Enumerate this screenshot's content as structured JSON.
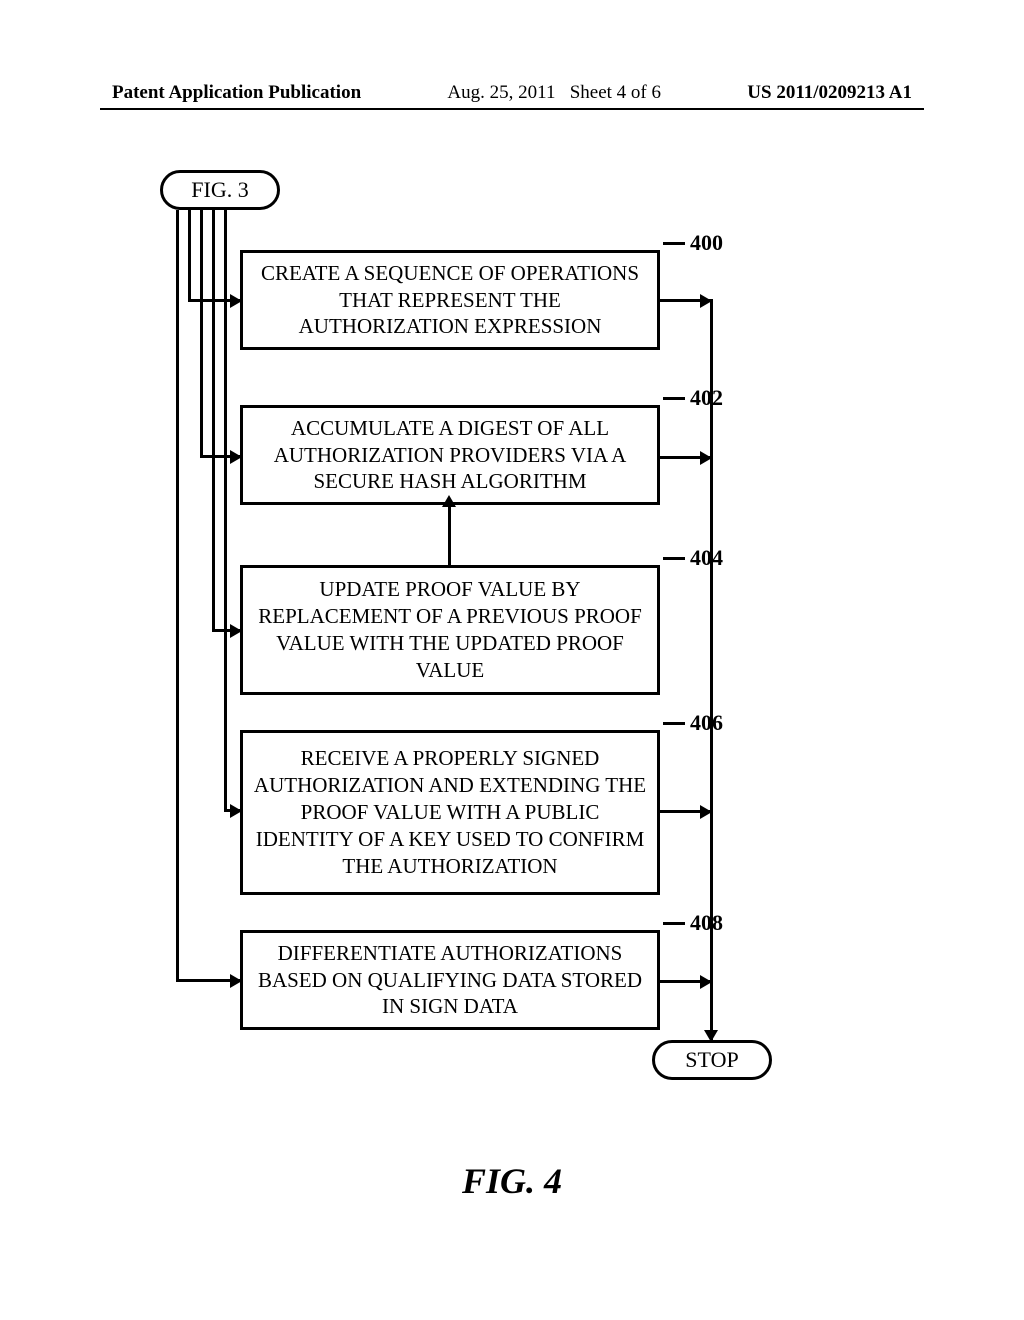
{
  "header": {
    "left": "Patent Application Publication",
    "date": "Aug. 25, 2011",
    "sheet": "Sheet 4 of 6",
    "pubno": "US 2011/0209213 A1"
  },
  "start_label": "FIG. 3",
  "stop_label": "STOP",
  "boxes": {
    "b400": {
      "ref": "400",
      "text": "CREATE A SEQUENCE OF OPERATIONS THAT REPRESENT THE AUTHORIZATION EXPRESSION"
    },
    "b402": {
      "ref": "402",
      "text": "ACCUMULATE A DIGEST OF ALL AUTHORIZATION PROVIDERS VIA A SECURE HASH ALGORITHM"
    },
    "b404": {
      "ref": "404",
      "text": "UPDATE PROOF VALUE BY REPLACEMENT OF A PREVIOUS PROOF VALUE WITH THE UPDATED PROOF VALUE"
    },
    "b406": {
      "ref": "406",
      "text": "RECEIVE A PROPERLY SIGNED AUTHORIZATION AND EXTENDING THE PROOF VALUE WITH A PUBLIC IDENTITY OF A KEY USED TO CONFIRM THE AUTHORIZATION"
    },
    "b408": {
      "ref": "408",
      "text": "DIFFERENTIATE AUTHORIZATIONS BASED ON QUALIFYING DATA STORED IN SIGN DATA"
    }
  },
  "figure_caption": "FIG. 4"
}
